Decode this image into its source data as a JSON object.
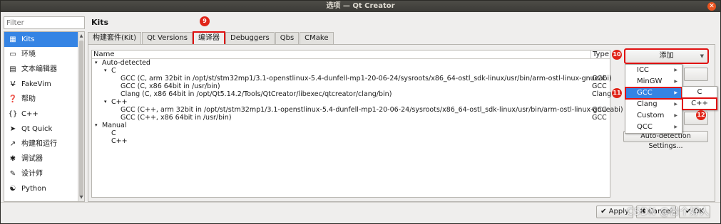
{
  "window": {
    "title": "选项 — Qt Creator"
  },
  "filter": {
    "placeholder": "Filter"
  },
  "sidebar": {
    "items": [
      {
        "label": "Kits",
        "icon": "kits-icon",
        "glyph": "▦"
      },
      {
        "label": "环境",
        "icon": "monitor-icon",
        "glyph": "▭"
      },
      {
        "label": "文本编辑器",
        "icon": "text-editor-icon",
        "glyph": "▤"
      },
      {
        "label": "FakeVim",
        "icon": "fakevim-icon",
        "glyph": "V̶"
      },
      {
        "label": "帮助",
        "icon": "help-icon",
        "glyph": "❓"
      },
      {
        "label": "C++",
        "icon": "cpp-icon",
        "glyph": "{}"
      },
      {
        "label": "Qt Quick",
        "icon": "qtquick-icon",
        "glyph": "➤"
      },
      {
        "label": "构建和运行",
        "icon": "build-run-icon",
        "glyph": "↗"
      },
      {
        "label": "调试器",
        "icon": "debugger-icon",
        "glyph": "✱"
      },
      {
        "label": "设计师",
        "icon": "designer-icon",
        "glyph": "✎"
      },
      {
        "label": "Python",
        "icon": "python-icon",
        "glyph": "☯"
      }
    ]
  },
  "main": {
    "title": "Kits",
    "tabs": [
      "构建套件(Kit)",
      "Qt Versions",
      "编译器",
      "Debuggers",
      "Qbs",
      "CMake"
    ],
    "active_tab": "编译器",
    "tree": {
      "columns": {
        "name": "Name",
        "type": "Type"
      },
      "rows": [
        {
          "indent": 0,
          "expander": "▾",
          "name": "Auto-detected",
          "type": ""
        },
        {
          "indent": 1,
          "expander": "▾",
          "name": "C",
          "type": ""
        },
        {
          "indent": 2,
          "expander": "",
          "name": "GCC (C, arm 32bit in /opt/st/stm32mp1/3.1-openstlinux-5.4-dunfell-mp1-20-06-24/sysroots/x86_64-ostl_sdk-linux/usr/bin/arm-ostl-linux-gnueabi)",
          "type": "GCC"
        },
        {
          "indent": 2,
          "expander": "",
          "name": "GCC (C, x86 64bit in /usr/bin)",
          "type": "GCC"
        },
        {
          "indent": 2,
          "expander": "",
          "name": "Clang (C, x86 64bit in /opt/Qt5.14.2/Tools/QtCreator/libexec/qtcreator/clang/bin)",
          "type": "Clang"
        },
        {
          "indent": 1,
          "expander": "▾",
          "name": "C++",
          "type": ""
        },
        {
          "indent": 2,
          "expander": "",
          "name": "GCC (C++, arm 32bit in /opt/st/stm32mp1/3.1-openstlinux-5.4-dunfell-mp1-20-06-24/sysroots/x86_64-ostl_sdk-linux/usr/bin/arm-ostl-linux-gnueabi)",
          "type": "GCC"
        },
        {
          "indent": 2,
          "expander": "",
          "name": "GCC (C++, x86 64bit in /usr/bin)",
          "type": "GCC"
        },
        {
          "indent": 0,
          "expander": "▾",
          "name": "Manual",
          "type": ""
        },
        {
          "indent": 1,
          "expander": "",
          "name": "C",
          "type": ""
        },
        {
          "indent": 1,
          "expander": "",
          "name": "C++",
          "type": ""
        }
      ]
    }
  },
  "actions": {
    "add_label": "添加",
    "auto_detection_label": "Auto-detection Settings...",
    "add_menu": [
      {
        "label": "ICC",
        "has_sub": true
      },
      {
        "label": "MinGW",
        "has_sub": true
      },
      {
        "label": "GCC",
        "has_sub": true,
        "selected": true
      },
      {
        "label": "Clang",
        "has_sub": true
      },
      {
        "label": "Custom",
        "has_sub": true
      },
      {
        "label": "QCC",
        "has_sub": true
      }
    ],
    "gcc_submenu": [
      "C",
      "C++"
    ]
  },
  "badges": [
    "9",
    "10",
    "11",
    "12"
  ],
  "footer": {
    "apply": "Apply",
    "cancel": "Cancel",
    "ok": "OK",
    "watermark": "CSDN @做个好人"
  },
  "colors": {
    "highlight_red": "#e01010",
    "selection_blue": "#3584e4",
    "badge_red": "#e02418"
  }
}
